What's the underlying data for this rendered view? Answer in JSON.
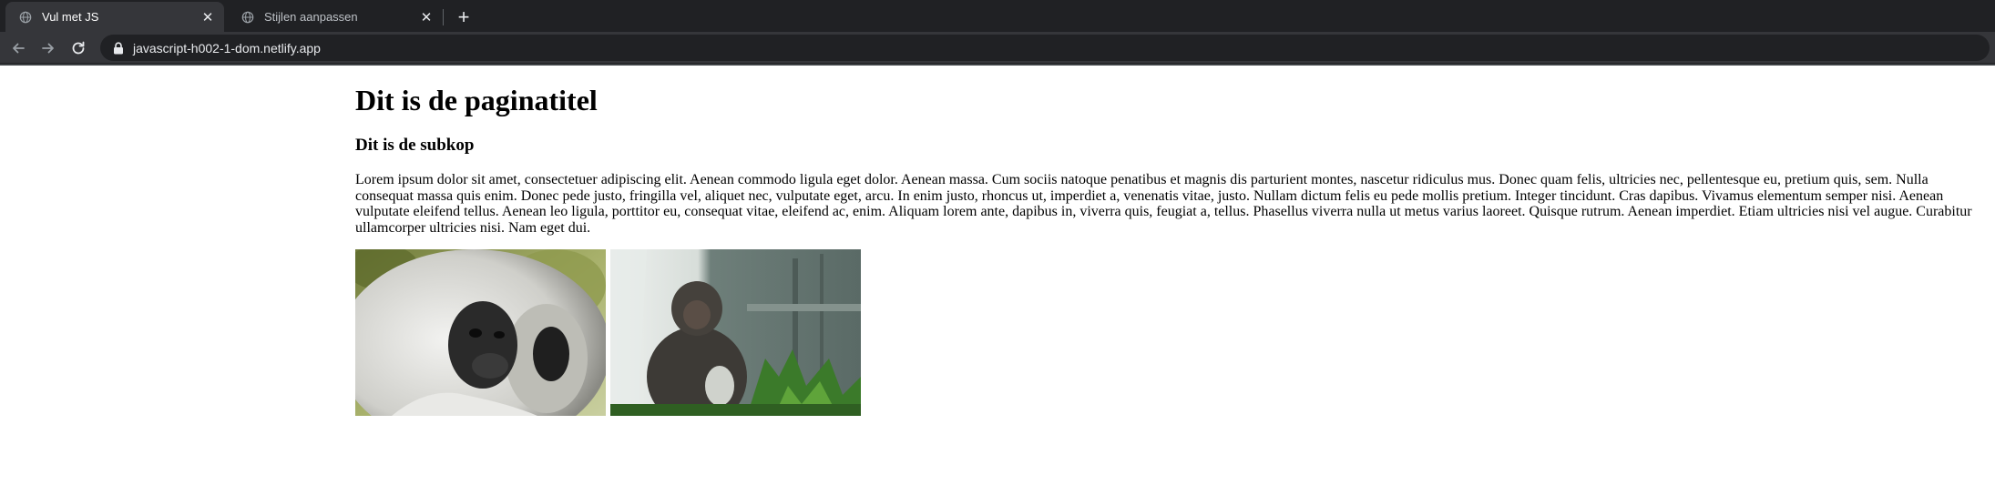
{
  "browser": {
    "tabs": [
      {
        "title": "Vul met JS",
        "active": true
      },
      {
        "title": "Stijlen aanpassen",
        "active": false
      }
    ],
    "close_glyph": "✕",
    "new_tab_glyph": "+",
    "url": "javascript-h002-1-dom.netlify.app"
  },
  "page": {
    "title": "Dit is de paginatitel",
    "subtitle": "Dit is de subkop",
    "paragraph": "Lorem ipsum dolor sit amet, consectetuer adipiscing elit. Aenean commodo ligula eget dolor. Aenean massa. Cum sociis natoque penatibus et magnis dis parturient montes, nascetur ridiculus mus. Donec quam felis, ultricies nec, pellentesque eu, pretium quis, sem. Nulla consequat massa quis enim. Donec pede justo, fringilla vel, aliquet nec, vulputate eget, arcu. In enim justo, rhoncus ut, imperdiet a, venenatis vitae, justo. Nullam dictum felis eu pede mollis pretium. Integer tincidunt. Cras dapibus. Vivamus elementum semper nisi. Aenean vulputate eleifend tellus. Aenean leo ligula, porttitor eu, consequat vitae, eleifend ac, enim. Aliquam lorem ante, dapibus in, viverra quis, feugiat a, tellus. Phasellus viverra nulla ut metus varius laoreet. Quisque rutrum. Aenean imperdiet. Etiam ultricies nisi vel augue. Curabitur ullamcorper ultricies nisi. Nam eget dui.",
    "images": [
      {
        "subject": "langur-monkey-photo"
      },
      {
        "subject": "macaque-monkey-photo"
      }
    ]
  }
}
